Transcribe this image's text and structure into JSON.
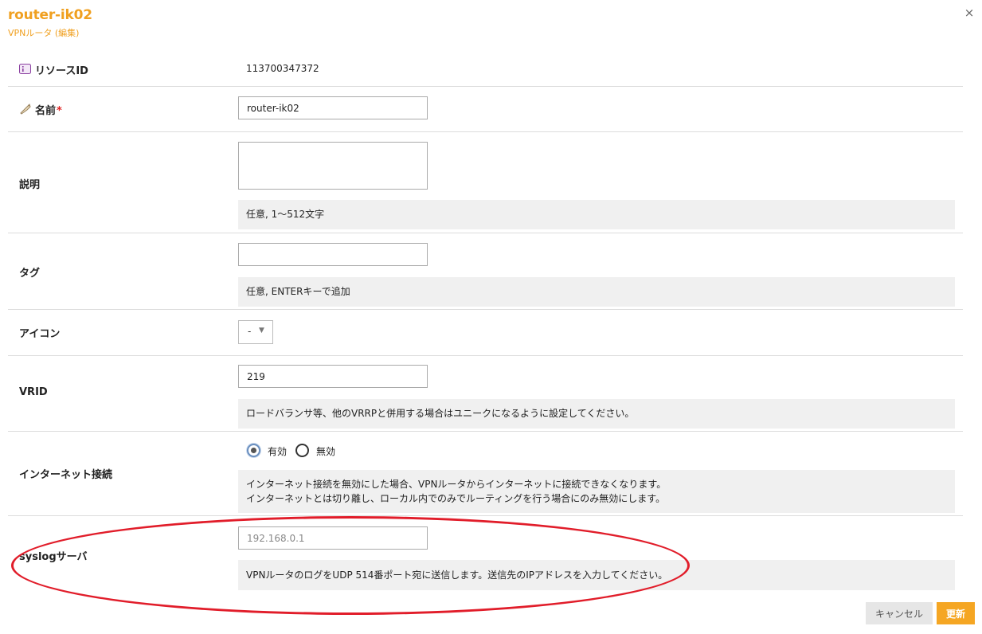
{
  "header": {
    "title": "router-ik02",
    "subtitle": "VPNルータ (編集)",
    "close_glyph": "×"
  },
  "fields": {
    "resource_id": {
      "label": "リソースID",
      "value": "113700347372"
    },
    "name": {
      "label": "名前",
      "required_mark": "*",
      "value": "router-ik02"
    },
    "description": {
      "label": "説明",
      "value": "",
      "help": "任意, 1〜512文字"
    },
    "tags": {
      "label": "タグ",
      "value": "",
      "help": "任意, ENTERキーで追加"
    },
    "icon": {
      "label": "アイコン",
      "selected": "-",
      "caret": "▼"
    },
    "vrid": {
      "label": "VRID",
      "value": "219",
      "help": "ロードバランサ等、他のVRRPと併用する場合はユニークになるように設定してください。"
    },
    "internet": {
      "label": "インターネット接続",
      "options": [
        {
          "label": "有効",
          "checked": true
        },
        {
          "label": "無効",
          "checked": false
        }
      ],
      "help_line1": "インターネット接続を無効にした場合、VPNルータからインターネットに接続できなくなります。",
      "help_line2": "インターネットとは切り離し、ローカル内でのみでルーティングを行う場合にのみ無効にします。"
    },
    "syslog": {
      "label": "syslogサーバ",
      "value": "",
      "placeholder": "192.168.0.1",
      "help": "VPNルータのログをUDP 514番ポート宛に送信します。送信先のIPアドレスを入力してください。"
    }
  },
  "footer": {
    "cancel_label": "キャンセル",
    "update_label": "更新"
  },
  "icons": {
    "resource_id": "id-card-icon",
    "name": "tag-icon"
  },
  "colors": {
    "accent": "#f0a020",
    "update_button": "#f5a623",
    "annotation": "#e11d2a",
    "required": "#e02020"
  }
}
